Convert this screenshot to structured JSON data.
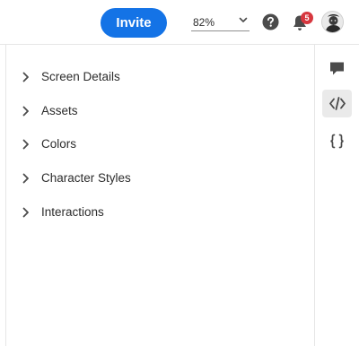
{
  "header": {
    "invite_label": "Invite",
    "zoom_value": "82%",
    "notification_count": "5"
  },
  "sections": [
    {
      "label": "Screen Details"
    },
    {
      "label": "Assets"
    },
    {
      "label": "Colors"
    },
    {
      "label": "Character Styles"
    },
    {
      "label": "Interactions"
    }
  ],
  "rail": {
    "items": [
      "comment-icon",
      "code-icon",
      "braces-icon"
    ],
    "active": "code-icon"
  },
  "colors": {
    "accent": "#1473e6",
    "badge": "#d7373f",
    "icon": "#4b4b4b"
  }
}
